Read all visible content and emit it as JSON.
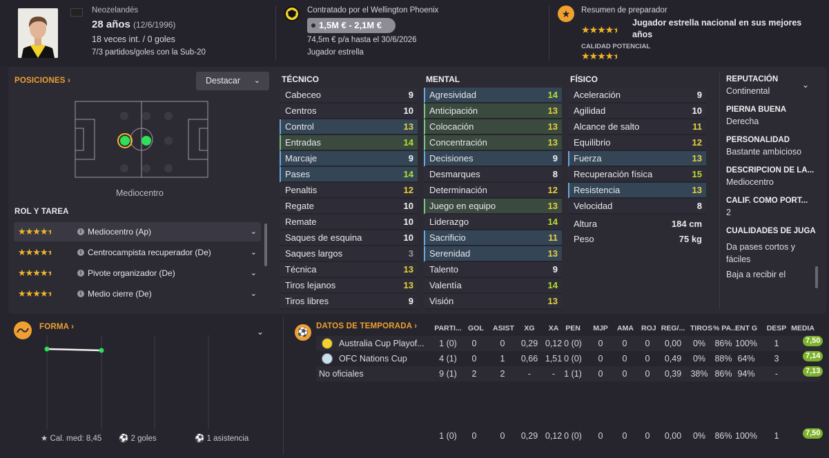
{
  "header": {
    "nationality": "Neozelandés",
    "age_label": "28 años",
    "birthdate": "(12/6/1996)",
    "caps": "18 veces int. / 0 goles",
    "u20": "7/3 partidos/goles con la Sub-20",
    "club_line": "Contratado por el Wellington Phoenix",
    "value_range": "1,5M € - 2,1M €",
    "wage": "74,5m € p/a hasta el 30/6/2026",
    "status": "Jugador estrella",
    "scout_title": "Resumen de preparador",
    "scout_text": "Jugador estrella nacional en sus mejores años",
    "potential_label": "CALIDAD POTENCIAL",
    "current_stars": 4.5,
    "potential_stars": 4.5
  },
  "positions": {
    "title": "POSICIONES",
    "dropdown": "Destacar",
    "position_name": "Mediocentro",
    "role_title": "ROL Y TAREA",
    "roles": [
      {
        "name": "Mediocentro (Ap)",
        "stars": 4.5
      },
      {
        "name": "Centrocampista recuperador (De)",
        "stars": 4.5
      },
      {
        "name": "Pivote organizador (De)",
        "stars": 4.5
      },
      {
        "name": "Medio cierre (De)",
        "stars": 4.5
      }
    ]
  },
  "technical": {
    "title": "TÉCNICO",
    "rows": [
      {
        "n": "Cabeceo",
        "v": "9",
        "c": "",
        "h": ""
      },
      {
        "n": "Centros",
        "v": "10",
        "c": "",
        "h": ""
      },
      {
        "n": "Control",
        "v": "13",
        "c": "y",
        "h": "blue"
      },
      {
        "n": "Entradas",
        "v": "14",
        "c": "g",
        "h": "green"
      },
      {
        "n": "Marcaje",
        "v": "9",
        "c": "",
        "h": "blue"
      },
      {
        "n": "Pases",
        "v": "14",
        "c": "g",
        "h": "blue"
      },
      {
        "n": "Penaltis",
        "v": "12",
        "c": "y",
        "h": ""
      },
      {
        "n": "Regate",
        "v": "10",
        "c": "",
        "h": ""
      },
      {
        "n": "Remate",
        "v": "10",
        "c": "",
        "h": ""
      },
      {
        "n": "Saques de esquina",
        "v": "10",
        "c": "",
        "h": ""
      },
      {
        "n": "Saques largos",
        "v": "3",
        "c": "dim",
        "h": ""
      },
      {
        "n": "Técnica",
        "v": "13",
        "c": "y",
        "h": ""
      },
      {
        "n": "Tiros lejanos",
        "v": "13",
        "c": "y",
        "h": ""
      },
      {
        "n": "Tiros libres",
        "v": "9",
        "c": "",
        "h": ""
      }
    ]
  },
  "mental": {
    "title": "MENTAL",
    "rows": [
      {
        "n": "Agresividad",
        "v": "14",
        "c": "g",
        "h": "blue"
      },
      {
        "n": "Anticipación",
        "v": "13",
        "c": "y",
        "h": "green"
      },
      {
        "n": "Colocación",
        "v": "13",
        "c": "y",
        "h": "green"
      },
      {
        "n": "Concentración",
        "v": "13",
        "c": "y",
        "h": "green"
      },
      {
        "n": "Decisiones",
        "v": "9",
        "c": "",
        "h": "blue"
      },
      {
        "n": "Desmarques",
        "v": "8",
        "c": "",
        "h": ""
      },
      {
        "n": "Determinación",
        "v": "12",
        "c": "y",
        "h": ""
      },
      {
        "n": "Juego en equipo",
        "v": "13",
        "c": "y",
        "h": "green"
      },
      {
        "n": "Liderazgo",
        "v": "14",
        "c": "g",
        "h": ""
      },
      {
        "n": "Sacrificio",
        "v": "11",
        "c": "y",
        "h": "blue"
      },
      {
        "n": "Serenidad",
        "v": "13",
        "c": "y",
        "h": "blue"
      },
      {
        "n": "Talento",
        "v": "9",
        "c": "",
        "h": ""
      },
      {
        "n": "Valentía",
        "v": "14",
        "c": "g",
        "h": ""
      },
      {
        "n": "Visión",
        "v": "13",
        "c": "y",
        "h": ""
      }
    ]
  },
  "physical": {
    "title": "FÍSICO",
    "rows": [
      {
        "n": "Aceleración",
        "v": "9",
        "c": "",
        "h": ""
      },
      {
        "n": "Agilidad",
        "v": "10",
        "c": "",
        "h": ""
      },
      {
        "n": "Alcance de salto",
        "v": "11",
        "c": "y",
        "h": ""
      },
      {
        "n": "Equilibrio",
        "v": "12",
        "c": "y",
        "h": ""
      },
      {
        "n": "Fuerza",
        "v": "13",
        "c": "y",
        "h": "blue"
      },
      {
        "n": "Recuperación física",
        "v": "15",
        "c": "g",
        "h": ""
      },
      {
        "n": "Resistencia",
        "v": "13",
        "c": "y",
        "h": "blue"
      },
      {
        "n": "Velocidad",
        "v": "8",
        "c": "",
        "h": ""
      }
    ],
    "height_label": "Altura",
    "height_value": "184 cm",
    "weight_label": "Peso",
    "weight_value": "75 kg"
  },
  "info": {
    "reputation_label": "REPUTACIÓN",
    "reputation_value": "Continental",
    "foot_label": "PIERNA BUENA",
    "foot_value": "Derecha",
    "personality_label": "PERSONALIDAD",
    "personality_value": "Bastante ambicioso",
    "description_label": "DESCRIPCIÓN DE LA...",
    "description_value": "Mediocentro",
    "gk_label": "CALIF. COMO PORT...",
    "gk_value": "2",
    "qualities_label": "CUALIDADES DE JUGA",
    "qualities_1": "Da pases cortos y fáciles",
    "qualities_2": "Baja a recibir el"
  },
  "form": {
    "title": "FORMA",
    "avg_rating": "Cal. med: 8,45",
    "goals": "2 goles",
    "assists": "1 asistencia"
  },
  "season": {
    "title": "DATOS DE TEMPORADA",
    "columns": [
      "PARTI...",
      "GOL",
      "ASIST",
      "XG",
      "XA",
      "PEN",
      "MJP",
      "AMA",
      "ROJ",
      "REG/...",
      "TIROS",
      "% PA...",
      "ENT G",
      "DESP",
      "MEDIA"
    ],
    "rows": [
      {
        "name": "Australia Cup Playof...",
        "cells": [
          "1 (0)",
          "0",
          "0",
          "0,29",
          "0,12",
          "0 (0)",
          "0",
          "0",
          "0",
          "0,00",
          "0%",
          "86%",
          "100%",
          "1"
        ],
        "media": "7,50"
      },
      {
        "name": "OFC Nations Cup",
        "cells": [
          "4 (1)",
          "0",
          "1",
          "0,66",
          "1,51",
          "0 (0)",
          "0",
          "0",
          "0",
          "0,49",
          "0%",
          "88%",
          "64%",
          "3"
        ],
        "media": "7,14"
      },
      {
        "name": "No oficiales",
        "cells": [
          "9 (1)",
          "2",
          "2",
          "-",
          "-",
          "1 (1)",
          "0",
          "0",
          "0",
          "0,39",
          "38%",
          "86%",
          "94%",
          "-"
        ],
        "media": "7,13"
      }
    ],
    "totals": {
      "cells": [
        "1 (0)",
        "0",
        "0",
        "0,29",
        "0,12",
        "0 (0)",
        "0",
        "0",
        "0",
        "0,00",
        "0%",
        "86%",
        "100%",
        "1"
      ],
      "media": "7,50"
    }
  },
  "colors": {
    "accent": "#f0a030",
    "rating_green": "#7db22c",
    "highlight_blue": "#344556",
    "highlight_green": "#3a4a3f"
  }
}
